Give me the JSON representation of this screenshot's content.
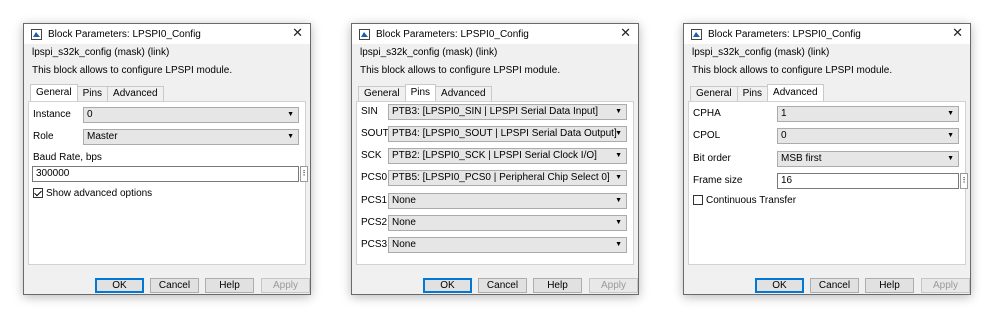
{
  "dialogs": [
    {
      "title": "Block Parameters: LPSPI0_Config",
      "header_line1": "lpspi_s32k_config (mask) (link)",
      "header_line2": "This block allows to configure LPSPI module.",
      "tabs": [
        "General",
        "Pins",
        "Advanced"
      ],
      "active_tab": "General",
      "general": {
        "instance_label": "Instance",
        "instance_value": "0",
        "role_label": "Role",
        "role_value": "Master",
        "baud_label": "Baud Rate, bps",
        "baud_value": "300000",
        "show_advanced_label": "Show advanced options",
        "show_advanced_checked": true
      }
    },
    {
      "title": "Block Parameters: LPSPI0_Config",
      "header_line1": "lpspi_s32k_config (mask) (link)",
      "header_line2": "This block allows to configure LPSPI module.",
      "tabs": [
        "General",
        "Pins",
        "Advanced"
      ],
      "active_tab": "Pins",
      "pins": [
        {
          "label": "SIN",
          "value": "PTB3: [LPSPI0_SIN | LPSPI Serial Data Input]"
        },
        {
          "label": "SOUT",
          "value": "PTB4: [LPSPI0_SOUT | LPSPI Serial Data Output]"
        },
        {
          "label": "SCK",
          "value": "PTB2: [LPSPI0_SCK | LPSPI Serial Clock I/O]"
        },
        {
          "label": "PCS0",
          "value": "PTB5: [LPSPI0_PCS0 | Peripheral Chip Select 0]"
        },
        {
          "label": "PCS1",
          "value": "None"
        },
        {
          "label": "PCS2",
          "value": "None"
        },
        {
          "label": "PCS3",
          "value": "None"
        }
      ]
    },
    {
      "title": "Block Parameters: LPSPI0_Config",
      "header_line1": "lpspi_s32k_config (mask) (link)",
      "header_line2": "This block allows to configure LPSPI module.",
      "tabs": [
        "General",
        "Pins",
        "Advanced"
      ],
      "active_tab": "Advanced",
      "advanced": {
        "cpha_label": "CPHA",
        "cpha_value": "1",
        "cpol_label": "CPOL",
        "cpol_value": "0",
        "bit_order_label": "Bit order",
        "bit_order_value": "MSB first",
        "frame_size_label": "Frame size",
        "frame_size_value": "16",
        "continuous_label": "Continuous Transfer",
        "continuous_checked": false
      }
    }
  ],
  "buttons": {
    "ok": "OK",
    "cancel": "Cancel",
    "help": "Help",
    "apply": "Apply"
  },
  "icons": {
    "app": "simulink-block-icon",
    "close": "close-icon",
    "dropdown": "chevron-down-icon",
    "more": "ellipsis-icon"
  },
  "colors": {
    "ok_border": "#0078d7",
    "dialog_bg": "#f0f0f0",
    "panel_bg": "#ffffff"
  }
}
